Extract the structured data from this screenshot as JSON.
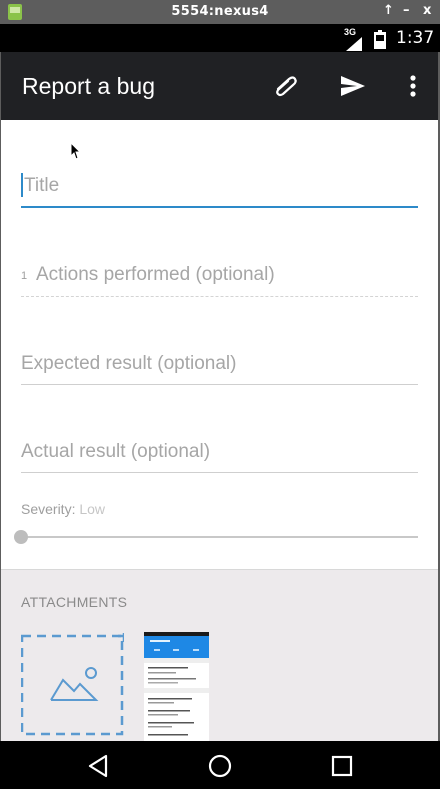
{
  "emulator": {
    "title": "5554:nexus4",
    "android_icon": "android-robot-icon",
    "pin_label": "↑",
    "minimize_label": "–",
    "close_label": "x"
  },
  "status_bar": {
    "network": "3G",
    "time": "1:37",
    "icons": [
      "signal-icon",
      "battery-icon"
    ]
  },
  "toolbar": {
    "title": "Report a bug",
    "actions": [
      "attach-icon",
      "send-icon",
      "more-vert-icon"
    ],
    "background": "#202124"
  },
  "form": {
    "title_placeholder": "Title",
    "actions_index": "1",
    "actions_placeholder": "Actions performed (optional)",
    "expected_placeholder": "Expected result (optional)",
    "actual_placeholder": "Actual result (optional)",
    "severity_label": "Severity:",
    "severity_value": "Low",
    "severity_level": 0,
    "accent": "#2d8ac9"
  },
  "attachments": {
    "header": "ATTACHMENTS",
    "add_icon": "add-image-icon"
  },
  "nav": {
    "buttons": [
      "back-icon",
      "home-icon",
      "recents-icon"
    ]
  }
}
